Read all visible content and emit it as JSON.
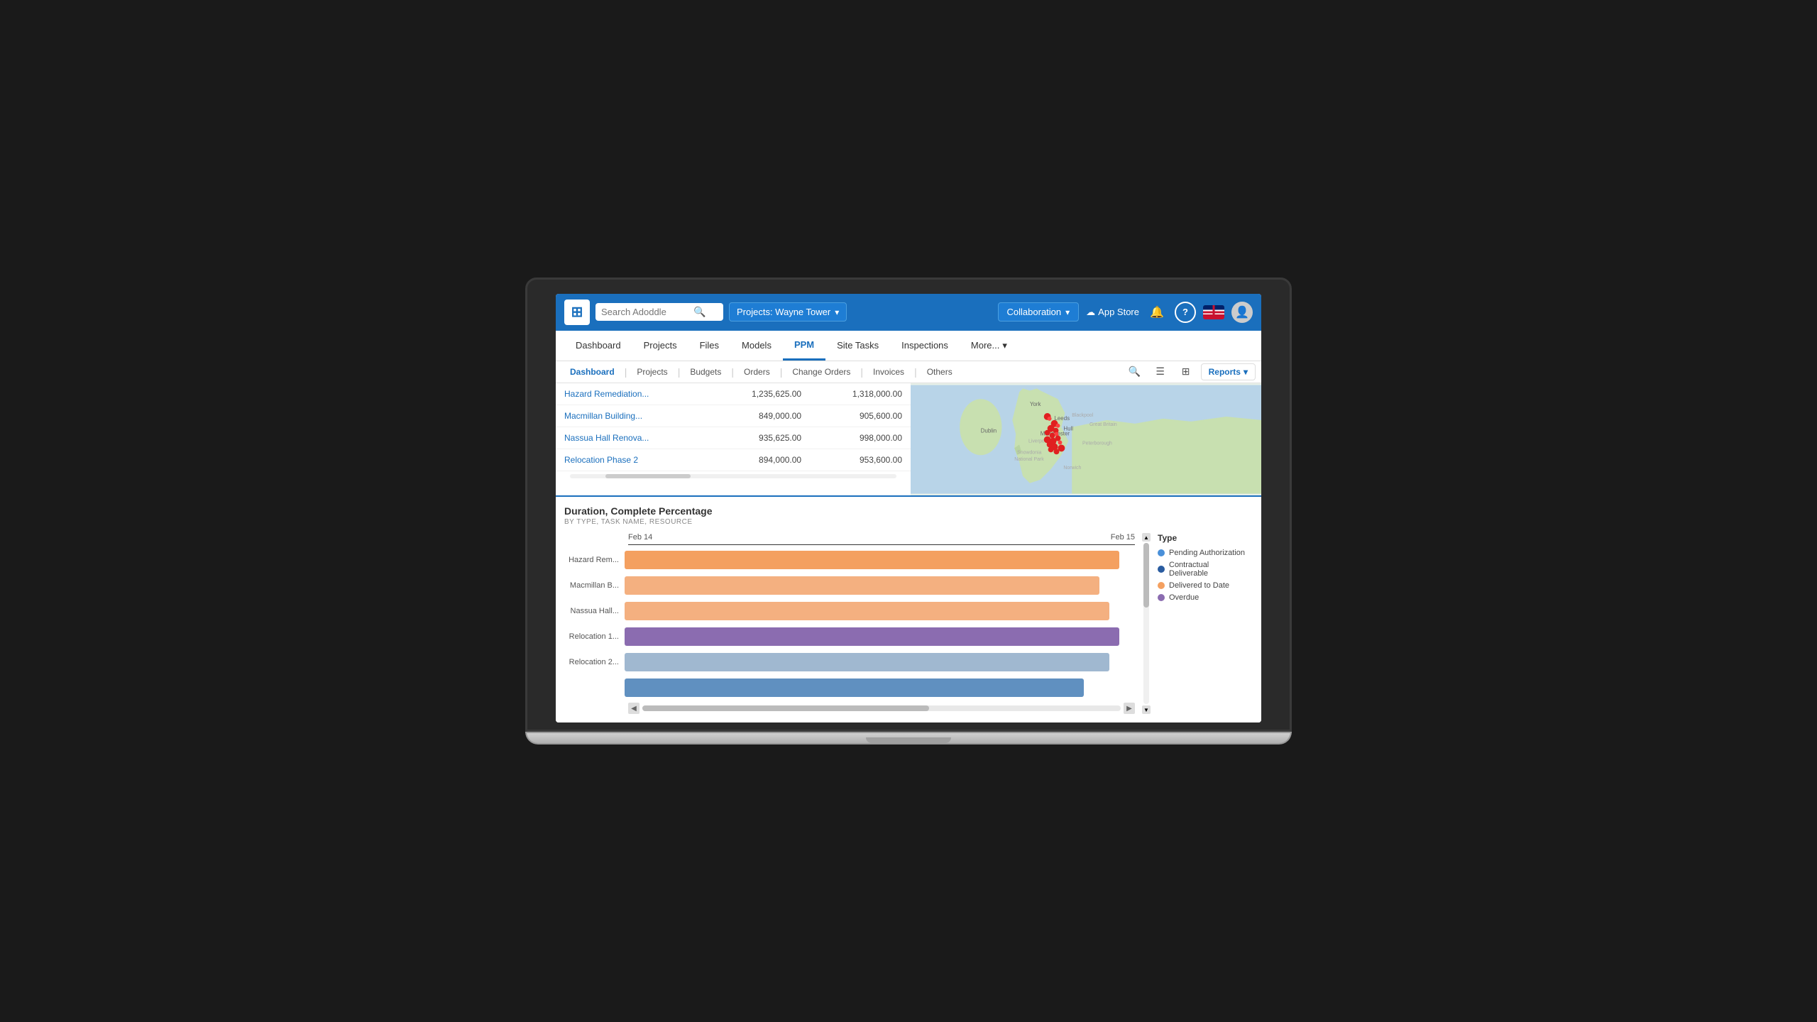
{
  "app": {
    "logo": "⊞",
    "search_placeholder": "Search Adoddle"
  },
  "topnav": {
    "project_label": "Projects: Wayne Tower",
    "collaboration_label": "Collaboration",
    "appstore_label": "App Store",
    "notification_icon": "🔔",
    "help_icon": "?",
    "flag_label": "UK Flag"
  },
  "mainnav": {
    "items": [
      {
        "label": "Dashboard",
        "active": false
      },
      {
        "label": "Projects",
        "active": false
      },
      {
        "label": "Files",
        "active": false
      },
      {
        "label": "Models",
        "active": false
      },
      {
        "label": "PPM",
        "active": true
      },
      {
        "label": "Site Tasks",
        "active": false
      },
      {
        "label": "Inspections",
        "active": false
      },
      {
        "label": "More...",
        "active": false
      }
    ]
  },
  "subnav": {
    "items": [
      {
        "label": "Dashboard",
        "active": true
      },
      {
        "label": "Projects",
        "active": false
      },
      {
        "label": "Budgets",
        "active": false
      },
      {
        "label": "Orders",
        "active": false
      },
      {
        "label": "Change Orders",
        "active": false
      },
      {
        "label": "Invoices",
        "active": false
      },
      {
        "label": "Others",
        "active": false
      }
    ],
    "reports_label": "Reports"
  },
  "table": {
    "rows": [
      {
        "name": "Hazard Remediation...",
        "col1": "1,235,625.00",
        "col2": "1,318,000.00"
      },
      {
        "name": "Macmillan Building...",
        "col1": "849,000.00",
        "col2": "905,600.00"
      },
      {
        "name": "Nassua Hall Renova...",
        "col1": "935,625.00",
        "col2": "998,000.00"
      },
      {
        "name": "Relocation Phase 2",
        "col1": "894,000.00",
        "col2": "953,600.00"
      }
    ]
  },
  "chart": {
    "title": "Duration, Complete Percentage",
    "subtitle": "BY TYPE, TASK NAME, RESOURCE",
    "date_start": "Feb 14",
    "date_end": "Feb 15",
    "rows": [
      {
        "label": "Hazard Rem...",
        "bar_width": "97%",
        "bar_class": "bar-orange"
      },
      {
        "label": "Macmillan B...",
        "bar_width": "93%",
        "bar_class": "bar-orange-light"
      },
      {
        "label": "Nassua Hall...",
        "bar_width": "95%",
        "bar_class": "bar-orange-light"
      },
      {
        "label": "Relocation 1...",
        "bar_width": "97%",
        "bar_class": "bar-purple"
      },
      {
        "label": "Relocation 2...",
        "bar_width": "95%",
        "bar_class": "bar-blue-light"
      },
      {
        "label": "...",
        "bar_width": "90%",
        "bar_class": "bar-blue"
      }
    ],
    "legend": {
      "title": "Type",
      "items": [
        {
          "label": "Pending Authorization",
          "dot_class": "dot-blue"
        },
        {
          "label": "Contractual Deliverable",
          "dot_class": "dot-dark-blue"
        },
        {
          "label": "Delivered to Date",
          "dot_class": "dot-orange"
        },
        {
          "label": "Overdue",
          "dot_class": "dot-purple"
        }
      ]
    }
  }
}
